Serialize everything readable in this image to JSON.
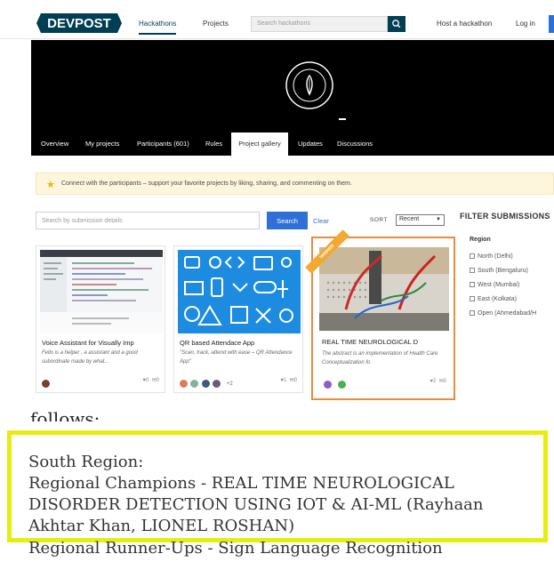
{
  "nav": {
    "logo": "DEVPOST",
    "links": [
      "Hackathons",
      "Projects"
    ],
    "search_placeholder": "Search hackathons",
    "right_links": [
      "Host a hackathon",
      "Log in"
    ]
  },
  "tabs": [
    "Overview",
    "My projects",
    "Participants (601)",
    "Rules",
    "Project gallery",
    "Updates",
    "Discussions"
  ],
  "notice": "Connect with the participants – support your favorite projects by liking, sharing, and commenting on them.",
  "gallery_search": {
    "placeholder": "Search by submission details",
    "button": "Search",
    "clear": "Clear",
    "sort_label": "SORT",
    "sort_value": "Recent"
  },
  "filter": {
    "title": "FILTER SUBMISSIONS",
    "region_title": "Region",
    "options": [
      "North (Delhi)",
      "South (Bengaluru)",
      "West (Mumbai)",
      "East (Kolkata)",
      "Open (Ahmedabad/H"
    ]
  },
  "cards": [
    {
      "title": "Voice Assistant for Visually Imp",
      "desc": "Fello is a helper , a assistant and a good subordinate made by what...",
      "likes": "0",
      "comments": "0",
      "extra_members": ""
    },
    {
      "title": "QR based Attendace App",
      "desc": "\"Scan, track, attend with ease – QR Attendance App\"",
      "likes": "1",
      "comments": "0",
      "extra_members": "+2"
    },
    {
      "title": "REAL TIME NEUROLOGICAL D",
      "desc": "The abstract is an implementation of Health Care Conceptualization fo",
      "likes": "2",
      "comments": "0",
      "extra_members": "",
      "badge": "WINNER"
    }
  ],
  "document": {
    "partial_top": "follows:",
    "lines": [
      "South Region:",
      "Regional Champions - REAL TIME NEUROLOGICAL",
      "DISORDER DETECTION USING IOT & AI-ML (Rayhaan",
      "Akhtar Khan, LIONEL ROSHAN)",
      "Regional Runner-Ups - Sign Language Recognition"
    ]
  },
  "colors": {
    "brand": "#003e54",
    "accent": "#2f6fd6",
    "highlight": "#e6ee10",
    "featured_border": "#e88d3c"
  }
}
